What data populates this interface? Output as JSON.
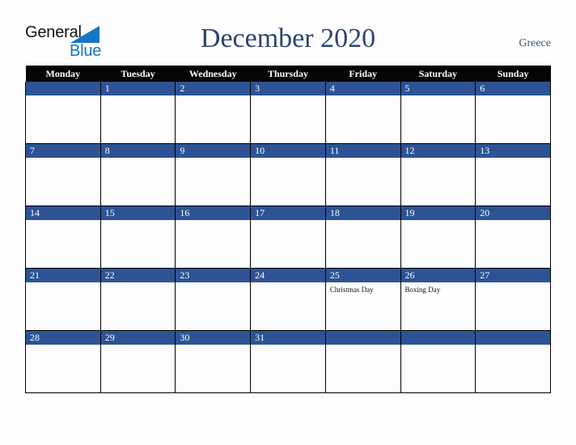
{
  "brand": {
    "name_part1": "General",
    "name_part2": "Blue",
    "triangle_icon": "triangle-icon",
    "color_dark": "#111111",
    "color_blue": "#1277c7"
  },
  "header": {
    "title": "December 2020",
    "region": "Greece",
    "title_color": "#2b4570"
  },
  "calendar": {
    "weekdays": [
      "Monday",
      "Tuesday",
      "Wednesday",
      "Thursday",
      "Friday",
      "Saturday",
      "Sunday"
    ],
    "header_bg": "#050505",
    "date_band_bg": "#2e5395",
    "date_text_color": "#ffffff",
    "weeks": [
      [
        {
          "day": "",
          "holiday": ""
        },
        {
          "day": "1",
          "holiday": ""
        },
        {
          "day": "2",
          "holiday": ""
        },
        {
          "day": "3",
          "holiday": ""
        },
        {
          "day": "4",
          "holiday": ""
        },
        {
          "day": "5",
          "holiday": ""
        },
        {
          "day": "6",
          "holiday": ""
        }
      ],
      [
        {
          "day": "7",
          "holiday": ""
        },
        {
          "day": "8",
          "holiday": ""
        },
        {
          "day": "9",
          "holiday": ""
        },
        {
          "day": "10",
          "holiday": ""
        },
        {
          "day": "11",
          "holiday": ""
        },
        {
          "day": "12",
          "holiday": ""
        },
        {
          "day": "13",
          "holiday": ""
        }
      ],
      [
        {
          "day": "14",
          "holiday": ""
        },
        {
          "day": "15",
          "holiday": ""
        },
        {
          "day": "16",
          "holiday": ""
        },
        {
          "day": "17",
          "holiday": ""
        },
        {
          "day": "18",
          "holiday": ""
        },
        {
          "day": "19",
          "holiday": ""
        },
        {
          "day": "20",
          "holiday": ""
        }
      ],
      [
        {
          "day": "21",
          "holiday": ""
        },
        {
          "day": "22",
          "holiday": ""
        },
        {
          "day": "23",
          "holiday": ""
        },
        {
          "day": "24",
          "holiday": ""
        },
        {
          "day": "25",
          "holiday": "Christmas Day"
        },
        {
          "day": "26",
          "holiday": "Boxing Day"
        },
        {
          "day": "27",
          "holiday": ""
        }
      ],
      [
        {
          "day": "28",
          "holiday": ""
        },
        {
          "day": "29",
          "holiday": ""
        },
        {
          "day": "30",
          "holiday": ""
        },
        {
          "day": "31",
          "holiday": ""
        },
        {
          "day": "",
          "holiday": ""
        },
        {
          "day": "",
          "holiday": ""
        },
        {
          "day": "",
          "holiday": ""
        }
      ]
    ]
  }
}
